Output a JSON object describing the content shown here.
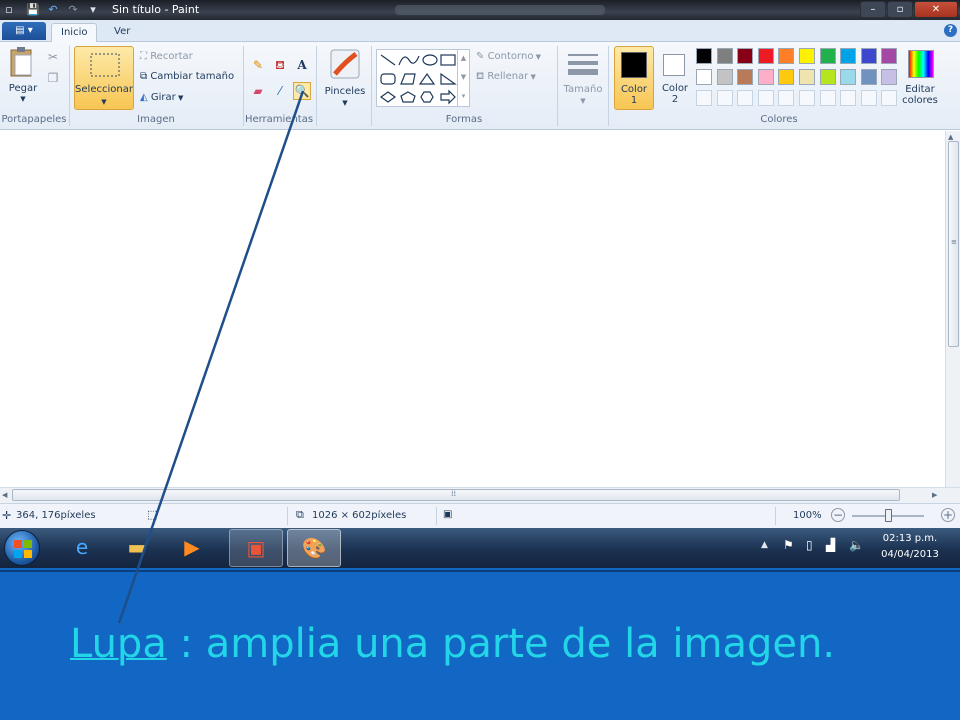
{
  "window": {
    "title": "Sin título - Paint"
  },
  "tabs": {
    "file_menu": "▤ ▾",
    "items": [
      {
        "label": "Inicio"
      },
      {
        "label": "Ver"
      }
    ]
  },
  "clipboard": {
    "paste_label": "Pegar",
    "group_label": "Portapapeles"
  },
  "image": {
    "select_label": "Seleccionar",
    "crop_label": "Recortar",
    "resize_label": "Cambiar tamaño",
    "rotate_label": "Girar",
    "group_label": "Imagen"
  },
  "tools": {
    "group_label": "Herramientas"
  },
  "brushes": {
    "label": "Pinceles"
  },
  "shapes": {
    "outline_label": "Contorno",
    "fill_label": "Rellenar",
    "group_label": "Formas"
  },
  "size": {
    "label": "Tamaño"
  },
  "colors": {
    "color1_label": "Color",
    "color1_num": "1",
    "color2_label": "Color",
    "color2_num": "2",
    "edit_label": "Editar",
    "edit_label2": "colores",
    "group_label": "Colores",
    "color1": "#000000",
    "color2": "#ffffff",
    "palette_row1": [
      "#000000",
      "#7f7f7f",
      "#880015",
      "#ed1c24",
      "#ff7f27",
      "#fff200",
      "#22b14c",
      "#00a2e8",
      "#3f48cc",
      "#a349a4"
    ],
    "palette_row2": [
      "#ffffff",
      "#c3c3c3",
      "#b97a57",
      "#ffaec9",
      "#ffc90e",
      "#efe4b0",
      "#b5e61d",
      "#99d9ea",
      "#7092be",
      "#c8bfe7"
    ]
  },
  "status": {
    "cursor_pos": "364, 176píxeles",
    "canvas_size": "1026 × 602píxeles",
    "zoom": "100%"
  },
  "taskbar": {
    "time": "02:13 p.m.",
    "date": "04/04/2013"
  },
  "caption": {
    "word": "Lupa",
    "rest": " : amplia una parte de la imagen."
  }
}
